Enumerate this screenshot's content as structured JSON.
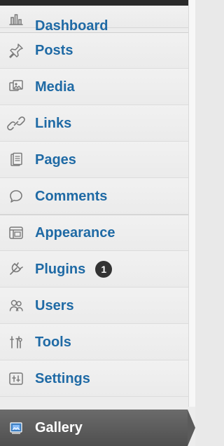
{
  "menu": {
    "items_top": [
      {
        "label": "Dashboard",
        "icon": "dashboard-icon"
      }
    ],
    "items_mid": [
      {
        "label": "Posts",
        "icon": "pin-icon"
      },
      {
        "label": "Media",
        "icon": "media-icon"
      },
      {
        "label": "Links",
        "icon": "link-icon"
      },
      {
        "label": "Pages",
        "icon": "pages-icon"
      },
      {
        "label": "Comments",
        "icon": "comment-icon"
      }
    ],
    "items_bottom": [
      {
        "label": "Appearance",
        "icon": "appearance-icon"
      },
      {
        "label": "Plugins",
        "icon": "plugin-icon",
        "badge": "1"
      },
      {
        "label": "Users",
        "icon": "users-icon"
      },
      {
        "label": "Tools",
        "icon": "tools-icon"
      },
      {
        "label": "Settings",
        "icon": "settings-icon"
      }
    ],
    "active_item": {
      "label": "Gallery",
      "icon": "gallery-icon"
    }
  }
}
